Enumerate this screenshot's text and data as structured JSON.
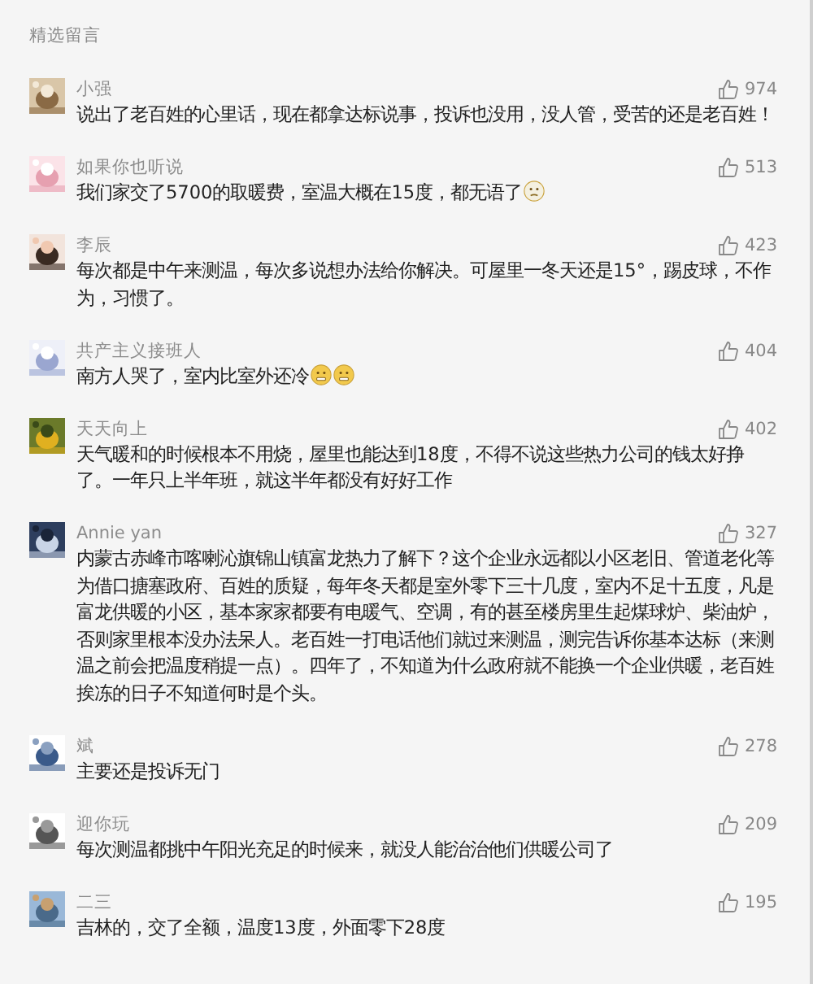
{
  "section_title": "精选留言",
  "comments": [
    {
      "name": "小强",
      "likes": "974",
      "text": "说出了老百姓的心里话，现在都拿达标说事，投诉也没用，没人管，受苦的还是老百姓！"
    },
    {
      "name": "如果你也听说",
      "likes": "513",
      "text": "我们家交了5700的取暖费，室温大概在15度，都无语了",
      "emojis": [
        {
          "kind": "neutral"
        }
      ]
    },
    {
      "name": "李辰",
      "likes": "423",
      "text": "每次都是中午来测温，每次多说想办法给你解决。可屋里一冬天还是15°，踢皮球，不作为，习惯了。"
    },
    {
      "name": "共产主义接班人",
      "likes": "404",
      "text": "南方人哭了，室内比室外还冷",
      "emojis": [
        {
          "kind": "grimace"
        },
        {
          "kind": "grimace"
        }
      ]
    },
    {
      "name": "天天向上",
      "likes": "402",
      "text": "天气暖和的时候根本不用烧，屋里也能达到18度，不得不说这些热力公司的钱太好挣了。一年只上半年班，就这半年都没有好好工作"
    },
    {
      "name": "Annie yan",
      "likes": "327",
      "text": "内蒙古赤峰市喀喇沁旗锦山镇富龙热力了解下？这个企业永远都以小区老旧、管道老化等为借口搪塞政府、百姓的质疑，每年冬天都是室外零下三十几度，室内不足十五度，凡是富龙供暖的小区，基本家家都要有电暖气、空调，有的甚至楼房里生起煤球炉、柴油炉，否则家里根本没办法呆人。老百姓一打电话他们就过来测温，测完告诉你基本达标（来测温之前会把温度稍提一点）。四年了，不知道为什么政府就不能换一个企业供暖，老百姓挨冻的日子不知道何时是个头。"
    },
    {
      "name": "斌",
      "likes": "278",
      "text": "主要还是投诉无门"
    },
    {
      "name": "迎你玩",
      "likes": "209",
      "text": "每次测温都挑中午阳光充足的时候来，就没人能治治他们供暖公司了"
    },
    {
      "name": "二三",
      "likes": "195",
      "text": "吉林的，交了全额，温度13度，外面零下28度"
    }
  ]
}
